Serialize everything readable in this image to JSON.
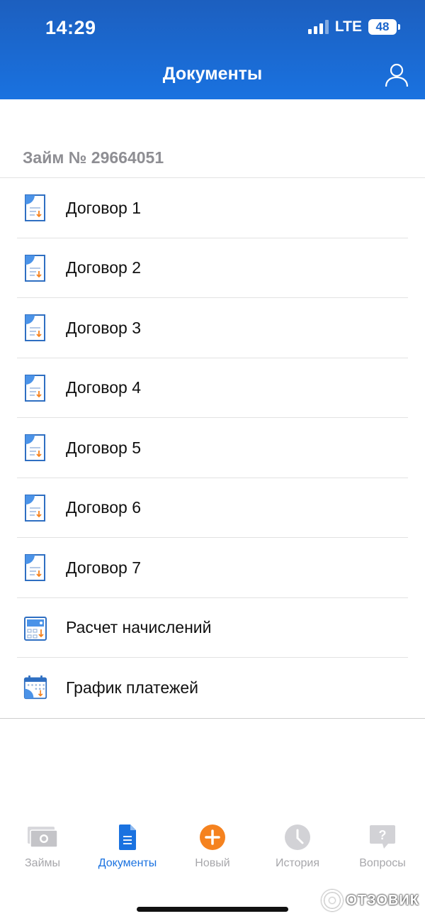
{
  "status_bar": {
    "time": "14:29",
    "network": "LTE",
    "battery": "48"
  },
  "header": {
    "title": "Документы",
    "profile_icon": "user-icon"
  },
  "loan": {
    "title": "Займ № 29664051"
  },
  "documents": [
    {
      "label": "Договор 1",
      "icon": "contract-doc-icon"
    },
    {
      "label": "Договор 2",
      "icon": "contract-doc-icon"
    },
    {
      "label": "Договор 3",
      "icon": "contract-doc-icon"
    },
    {
      "label": "Договор 4",
      "icon": "contract-doc-icon"
    },
    {
      "label": "Договор 5",
      "icon": "contract-doc-icon"
    },
    {
      "label": "Договор 6",
      "icon": "contract-doc-icon"
    },
    {
      "label": "Договор 7",
      "icon": "contract-doc-icon"
    },
    {
      "label": "Расчет начислений",
      "icon": "calculator-icon"
    },
    {
      "label": "График платежей",
      "icon": "calendar-icon"
    }
  ],
  "tabbar": {
    "active": "documents",
    "tabs": [
      {
        "id": "loans",
        "label": "Займы",
        "icon": "money-icon"
      },
      {
        "id": "documents",
        "label": "Документы",
        "icon": "document-icon"
      },
      {
        "id": "new",
        "label": "Новый",
        "icon": "plus-circle-icon"
      },
      {
        "id": "history",
        "label": "История",
        "icon": "clock-icon"
      },
      {
        "id": "faq",
        "label": "Вопросы",
        "icon": "question-bubble-icon"
      }
    ]
  },
  "watermark": {
    "text": "ОТЗОВИК"
  },
  "colors": {
    "brand_blue": "#1a72e0",
    "accent_orange": "#f5821f",
    "inactive_gray": "#a7a7ab"
  }
}
